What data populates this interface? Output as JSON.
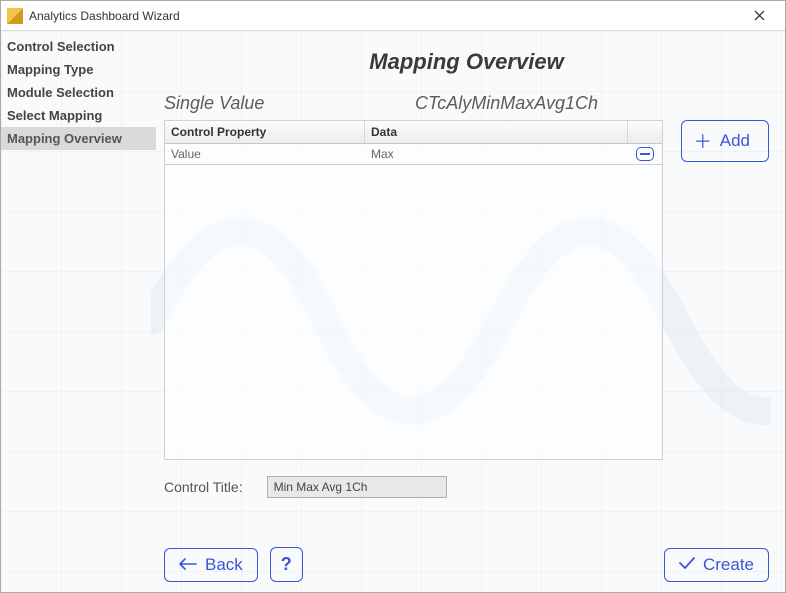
{
  "window": {
    "title": "Analytics Dashboard Wizard"
  },
  "sidebar": {
    "items": [
      {
        "label": "Control Selection"
      },
      {
        "label": "Mapping Type"
      },
      {
        "label": "Module Selection"
      },
      {
        "label": "Select Mapping"
      },
      {
        "label": "Mapping Overview"
      }
    ],
    "active_index": 4
  },
  "main": {
    "title": "Mapping Overview",
    "subhead_left": "Single Value",
    "subhead_right": "CTcAlyMinMaxAvg1Ch",
    "columns": {
      "c1": "Control Property",
      "c2": "Data"
    },
    "rows": [
      {
        "control_property": "Value",
        "data": "Max"
      }
    ],
    "add_label": "Add",
    "control_title_label": "Control Title:",
    "control_title_value": "Min Max Avg 1Ch"
  },
  "footer": {
    "back": "Back",
    "help": "?",
    "create": "Create"
  }
}
